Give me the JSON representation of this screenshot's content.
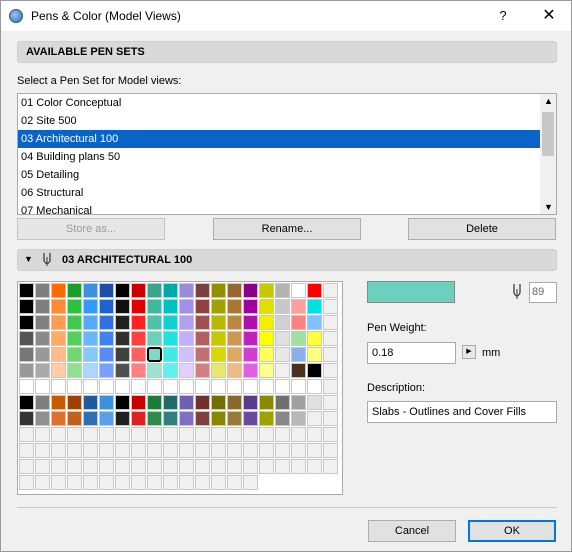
{
  "window": {
    "title": "Pens & Color (Model Views)",
    "help": "?",
    "close": "✕"
  },
  "available": {
    "header": "AVAILABLE PEN SETS",
    "select_label": "Select a Pen Set for Model views:",
    "items": [
      "01 Color Conceptual",
      "02 Site 500",
      "03 Architectural 100",
      "04 Building plans 50",
      "05 Detailing",
      "06 Structural",
      "07 Mechanical"
    ],
    "selected_index": 2
  },
  "buttons": {
    "store": "Store as...",
    "rename": "Rename...",
    "delete": "Delete",
    "cancel": "Cancel",
    "ok": "OK"
  },
  "penset": {
    "header": "03 ARCHITECTURAL 100",
    "selected_color": "#6dcfbe",
    "pen_number": "89",
    "pen_weight_label": "Pen Weight:",
    "pen_weight_value": "0.18",
    "unit": "mm",
    "description_label": "Description:",
    "description_value": "Slabs - Outlines and Cover Fills",
    "selected_cell": "r4c8"
  }
}
